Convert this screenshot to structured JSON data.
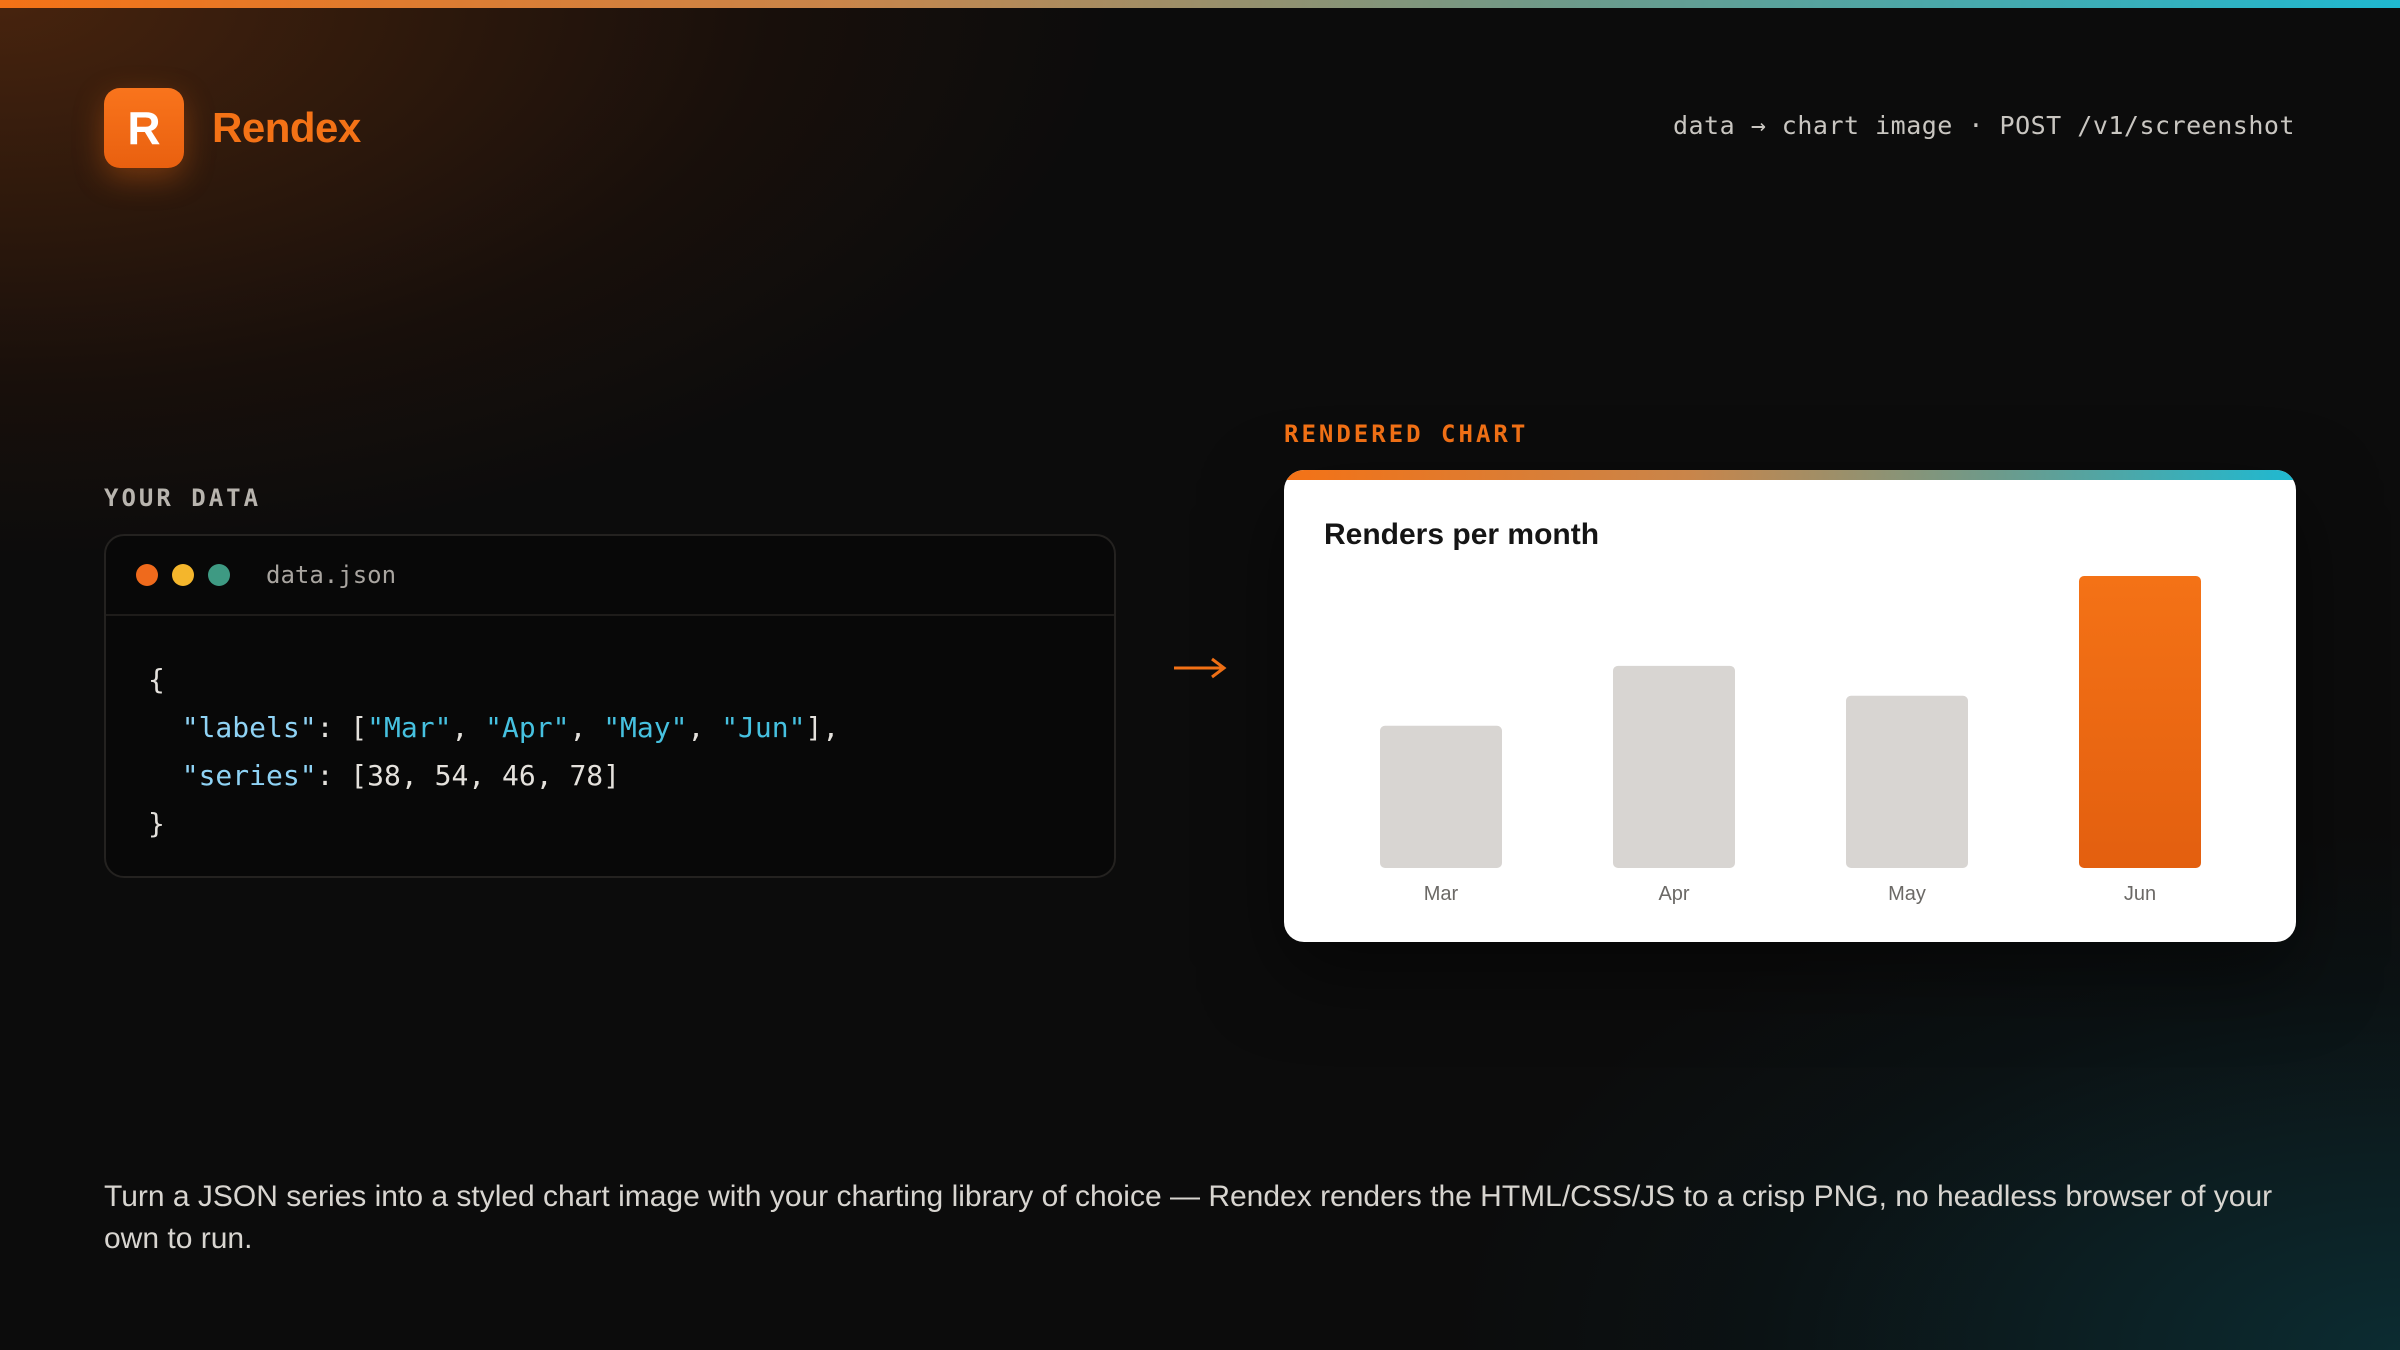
{
  "brand": {
    "logo_letter": "R",
    "name": "Rendex"
  },
  "header": {
    "tag": "data → chart image · POST /v1/screenshot"
  },
  "data_section": {
    "label": "YOUR DATA",
    "file_name": "data.json",
    "code": {
      "open": "{",
      "labels_key": "\"labels\"",
      "labels_values": [
        "\"Mar\"",
        "\"Apr\"",
        "\"May\"",
        "\"Jun\""
      ],
      "series_key": "\"series\"",
      "series_values": "[38, 54, 46, 78]",
      "close": "}"
    }
  },
  "chart_section": {
    "label": "RENDERED CHART"
  },
  "chart_data": {
    "type": "bar",
    "title": "Renders per month",
    "categories": [
      "Mar",
      "Apr",
      "May",
      "Jun"
    ],
    "values": [
      38,
      54,
      46,
      78
    ],
    "ylim": [
      0,
      78
    ],
    "highlight_index": 3,
    "colors": {
      "bar": "#d8d5d2",
      "highlight": "#f47216",
      "highlight_bottom": "#e35f0f"
    },
    "grid": false
  },
  "colors": {
    "accent": "#f47216",
    "teal": "#1fb9d1"
  },
  "tagline": "Turn a JSON series into a styled chart image with your charting library of choice — Rendex renders the HTML/CSS/JS to a crisp PNG, no headless browser of your own to run."
}
